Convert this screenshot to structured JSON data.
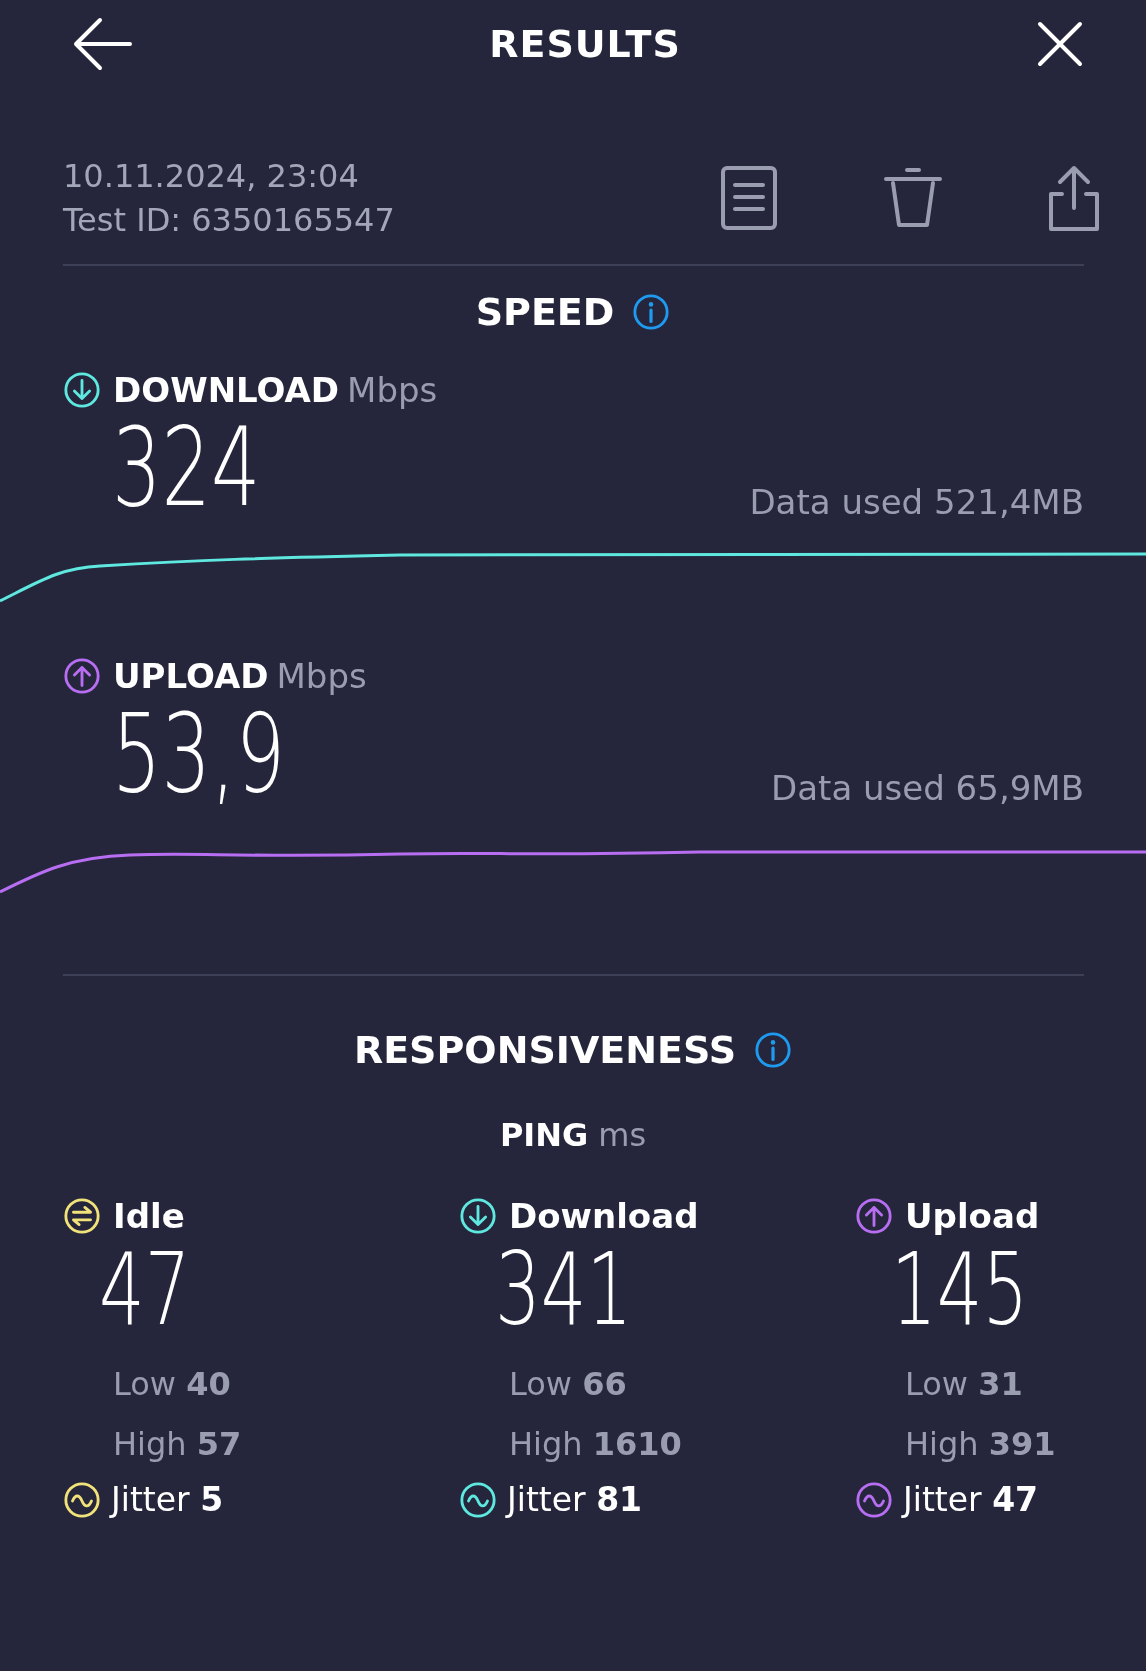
{
  "header": {
    "title": "RESULTS"
  },
  "test": {
    "date": "10.11.2024, 23:04",
    "test_id": "Test ID: 6350165547"
  },
  "speed": {
    "title": "SPEED",
    "metrics": [
      {
        "kind": "download",
        "label": "DOWNLOAD",
        "unit": "Mbps",
        "value": "324",
        "data_used": "Data used 521,4MB",
        "color": "#5ee8df"
      },
      {
        "kind": "upload",
        "label": "UPLOAD",
        "unit": "Mbps",
        "value": "53,9",
        "data_used": "Data used 65,9MB",
        "color": "#b86ef2"
      }
    ]
  },
  "responsiveness": {
    "title": "RESPONSIVENESS",
    "ping_label": "PING",
    "ping_unit": "ms",
    "columns": [
      {
        "kind": "idle",
        "label": "Idle",
        "value": "47",
        "low": "Low **40**",
        "high": "High **57**",
        "jitter": "Jitter **5**",
        "color": "#f2e27a"
      },
      {
        "kind": "download",
        "label": "Download",
        "value": "341",
        "low": "Low **66**",
        "high": "High **1610**",
        "jitter": "Jitter **81**",
        "color": "#5ee8df"
      },
      {
        "kind": "upload",
        "label": "Upload",
        "value": "145",
        "low": "Low **31**",
        "high": "High **391**",
        "jitter": "Jitter **47**",
        "color": "#b86ef2"
      }
    ]
  }
}
